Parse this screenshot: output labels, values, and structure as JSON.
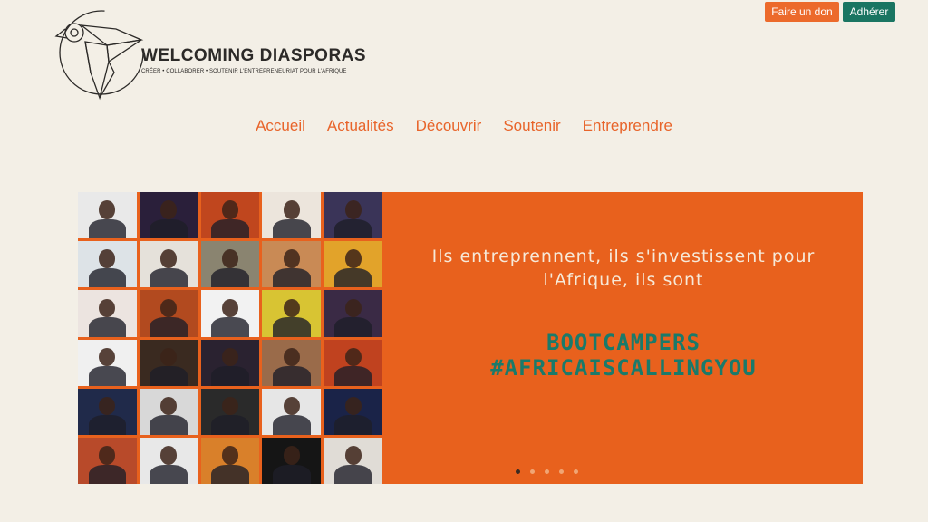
{
  "top_buttons": {
    "donate": "Faire un don",
    "join": "Adhérer"
  },
  "logo": {
    "name": "WELCOMING DIASPORAS",
    "tagline": "CRÉER • COLLABORER • SOUTENIR L'ENTREPRENEURIAT POUR L'AFRIQUE"
  },
  "nav": {
    "items": [
      "Accueil",
      "Actualités",
      "Découvrir",
      "Soutenir",
      "Entreprendre"
    ]
  },
  "hero": {
    "intro": "Ils entreprennent, ils s'investissent pour l'Afrique, ils sont",
    "headline_line1": "BOOTCAMPERS",
    "headline_line2": "#AFRICAISCALLINGYOU",
    "slide_count": 5,
    "active_slide": 1
  },
  "colors": {
    "accent_orange": "#e8611d",
    "accent_green": "#1a7562",
    "background": "#f3efe6"
  },
  "photo_grid_bg": [
    "#e9e9e9",
    "#2a1f3a",
    "#c0461e",
    "#ece5dc",
    "#3a3458",
    "#dde3e7",
    "#e5e1da",
    "#8a8470",
    "#c98a55",
    "#e2a32a",
    "#ece4e0",
    "#b24a1f",
    "#f2f2f2",
    "#d8c433",
    "#3a2a45",
    "#f0f0f0",
    "#3a2a20",
    "#2a2230",
    "#9a6b4a",
    "#c0421f",
    "#202a4a",
    "#d8d8d8",
    "#2a2a2a",
    "#e6e6e6",
    "#1a2348",
    "#b84a2a",
    "#e8e8e8",
    "#d9802a",
    "#151515",
    "#e0dcd6"
  ]
}
